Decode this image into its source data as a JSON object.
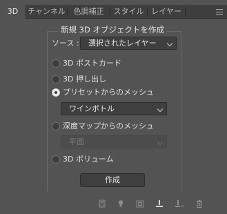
{
  "tabs": [
    {
      "label": "3D",
      "active": true
    },
    {
      "label": "チャンネル",
      "active": false
    },
    {
      "label": "色調補正",
      "active": false
    },
    {
      "label": "スタイル",
      "active": false
    },
    {
      "label": "レイヤー",
      "active": false
    }
  ],
  "panel_menu_icon": "hamburger-menu-icon",
  "group": {
    "title": "新規 3D オブジェクトを作成"
  },
  "source": {
    "label": "ソース :",
    "selected": "選択されたレイヤー"
  },
  "options": [
    {
      "label": "3D ポストカード",
      "checked": false
    },
    {
      "label": "3D 押し出し",
      "checked": false
    },
    {
      "label": "プリセットからのメッシュ",
      "checked": true
    },
    {
      "label": "深度マップからのメッシュ",
      "checked": false
    },
    {
      "label": "3D ボリューム",
      "checked": false
    }
  ],
  "preset_select": {
    "selected": "ワインボトル",
    "enabled": true
  },
  "depth_select": {
    "selected": "平面",
    "enabled": false
  },
  "create_button": {
    "label": "作成"
  },
  "toolbar_icons": [
    "calculator-icon",
    "lightbulb-icon",
    "frame-icon",
    "ground-plane-icon",
    "light-adjust-icon",
    "trash-icon"
  ],
  "colors": {
    "panel_bg": "#535353",
    "tabbar_bg": "#3e3e3e",
    "control_bg": "#3f3f3f"
  }
}
